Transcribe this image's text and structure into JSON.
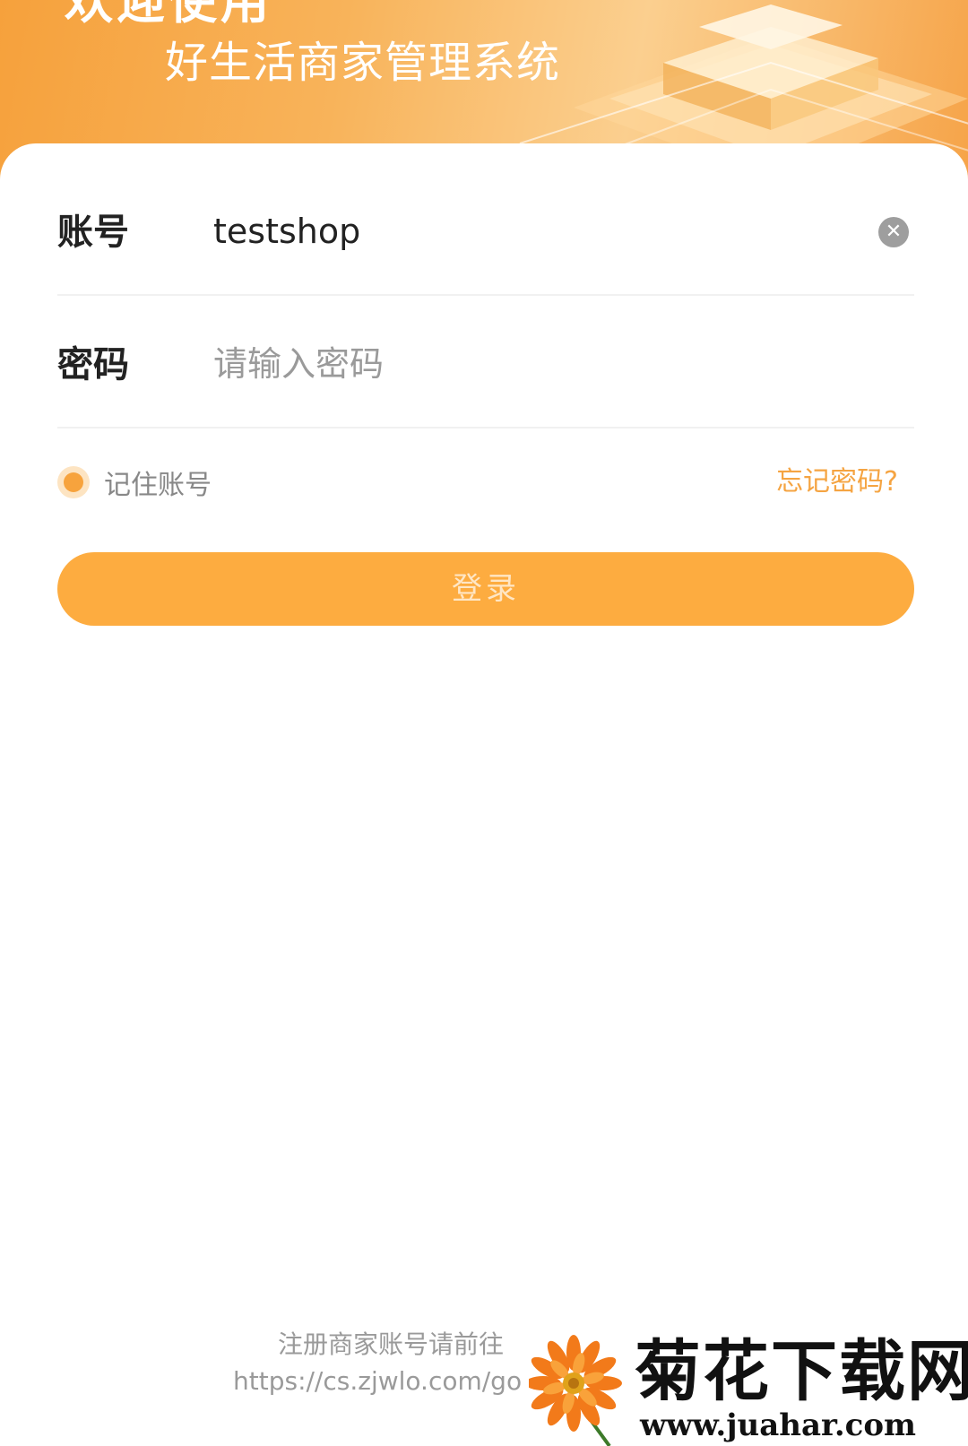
{
  "header": {
    "welcome": "欢迎使用",
    "subtitle": "好生活商家管理系统"
  },
  "form": {
    "account_label": "账号",
    "account_value": "testshop",
    "password_label": "密码",
    "password_placeholder": "请输入密码",
    "remember_label": "记住账号",
    "forgot_link": "忘记密码?",
    "login_button": "登录"
  },
  "footer": {
    "register_text": "注册商家账号请前往",
    "register_url": "https://cs.zjwlo.com/go"
  },
  "watermark": {
    "title": "菊花下载网",
    "url": "www.juahar.com"
  },
  "colors": {
    "accent": "#fdac40",
    "link": "#f5a442"
  }
}
